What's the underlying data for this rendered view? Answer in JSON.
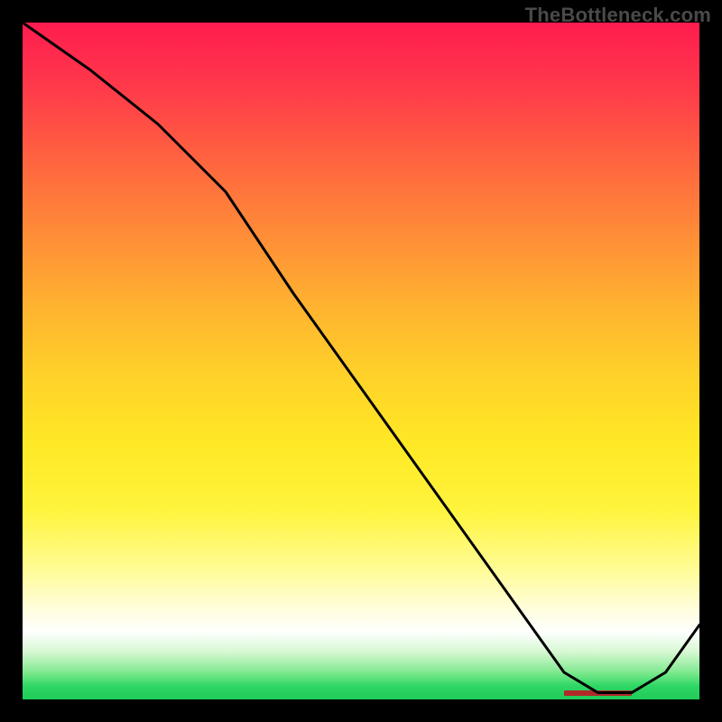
{
  "watermark": "TheBottleneck.com",
  "chart_data": {
    "type": "line",
    "title": "",
    "xlabel": "",
    "ylabel": "",
    "xlim": [
      0,
      100
    ],
    "ylim": [
      0,
      100
    ],
    "grid": false,
    "legend": false,
    "background": "thermal-gradient",
    "series": [
      {
        "name": "curve",
        "color": "#000000",
        "x": [
          0,
          10,
          20,
          30,
          40,
          50,
          60,
          70,
          80,
          85,
          90,
          95,
          100
        ],
        "y": [
          100,
          93,
          85,
          75,
          60,
          46,
          32,
          18,
          4,
          1,
          1,
          4,
          11
        ]
      }
    ],
    "annotation": {
      "name": "target-band",
      "color": "#b02a2a",
      "x_range": [
        80,
        90
      ],
      "y": 1
    }
  },
  "colors": {
    "frame": "#000000",
    "watermark": "#4a4a4a",
    "marker": "#b02a2a"
  }
}
